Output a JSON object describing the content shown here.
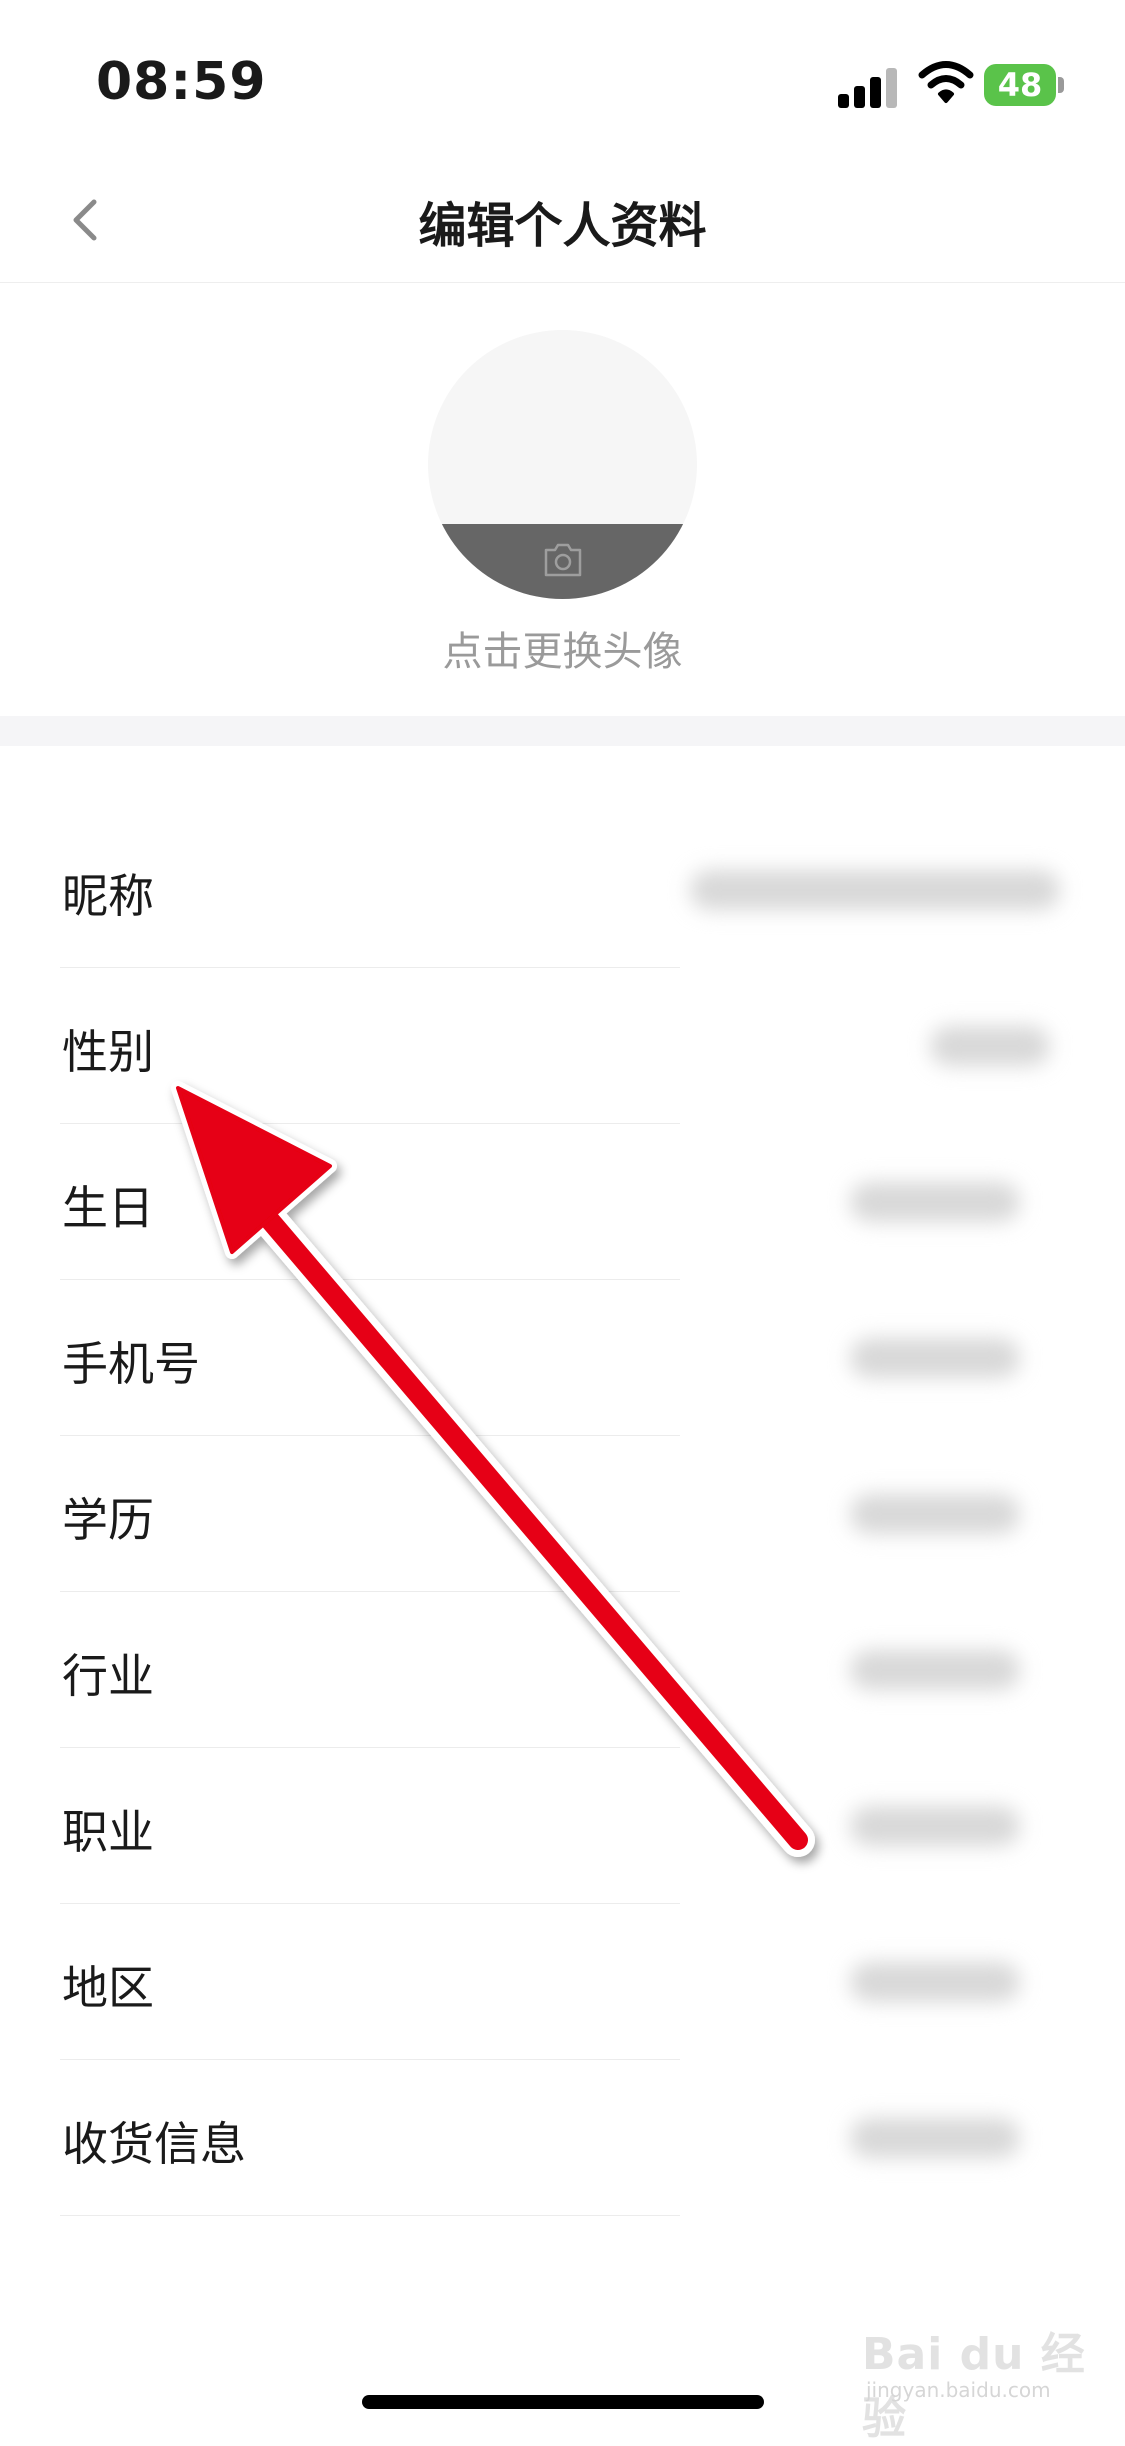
{
  "status_bar": {
    "time": "08:59",
    "battery": "48"
  },
  "nav": {
    "title": "编辑个人资料",
    "back_icon": "chevron-left-icon"
  },
  "avatar": {
    "hint": "点击更换头像",
    "icon": "camera-icon"
  },
  "fields": [
    {
      "label": "昵称"
    },
    {
      "label": "性别"
    },
    {
      "label": "生日"
    },
    {
      "label": "手机号"
    },
    {
      "label": "学历"
    },
    {
      "label": "行业"
    },
    {
      "label": "职业"
    },
    {
      "label": "地区"
    },
    {
      "label": "收货信息"
    }
  ],
  "watermark": {
    "brand": "Bai du 经验",
    "url": "jingyan.baidu.com"
  },
  "colors": {
    "arrow": "#e60012",
    "battery": "#5ac34a",
    "avatar_overlay": "#666666"
  }
}
